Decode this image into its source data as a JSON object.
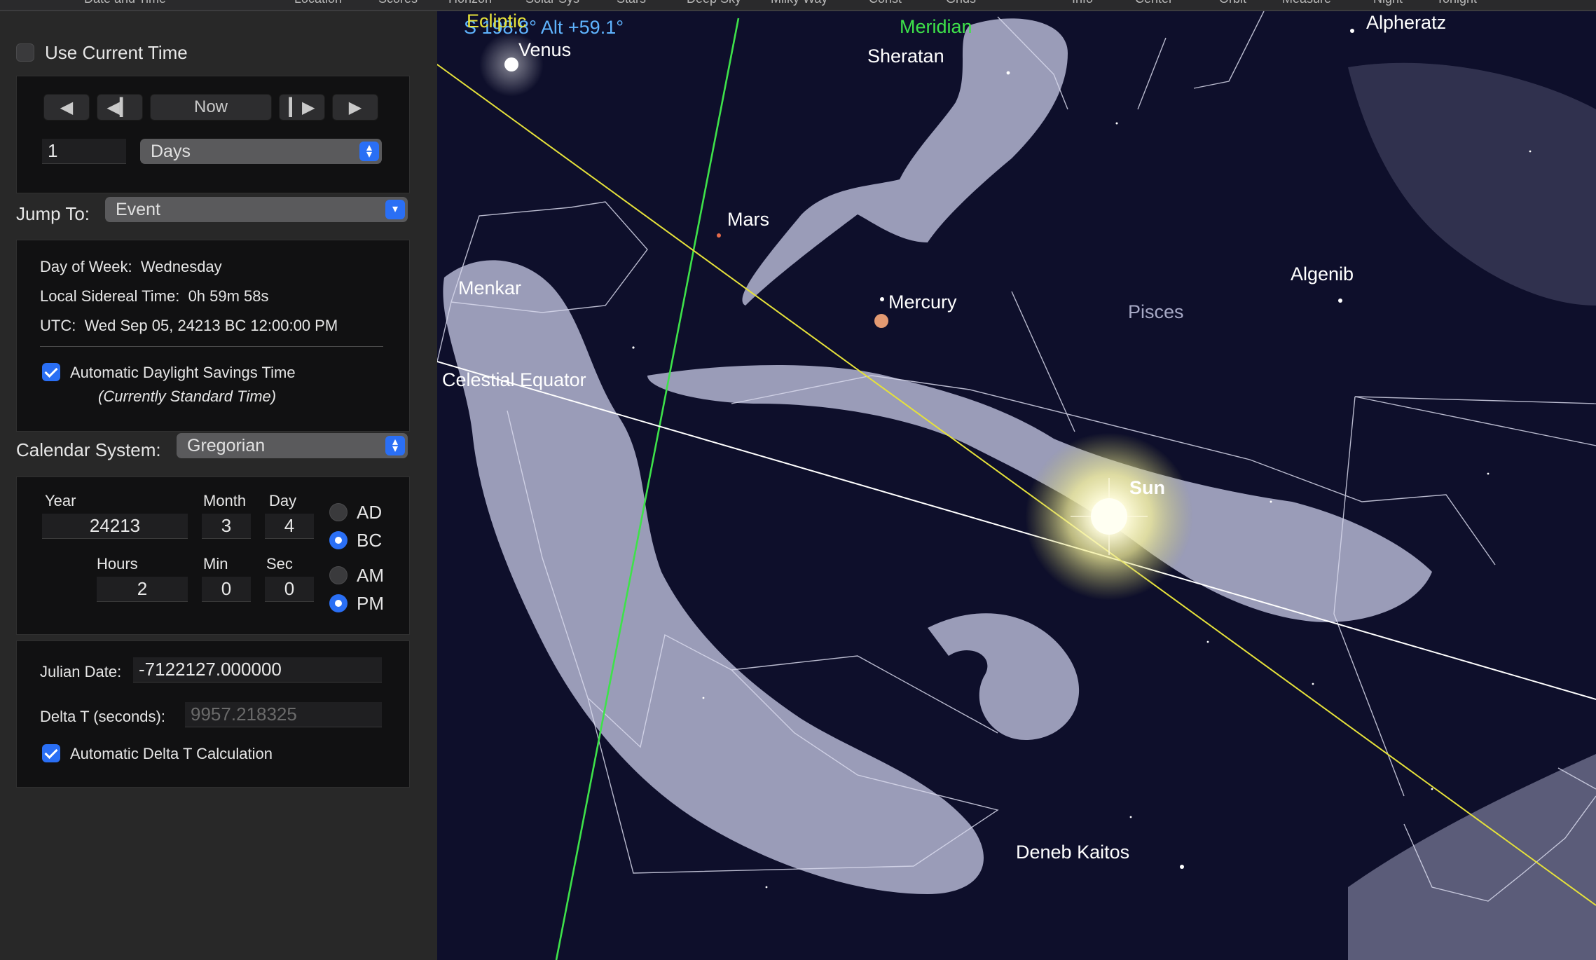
{
  "toolbar": {
    "items": [
      "Date and Time",
      "Location",
      "Scores",
      "Horizon",
      "Solar Sys",
      "Stars",
      "Deep Sky",
      "Milky Way",
      "Const",
      "Grids",
      "Info",
      "Center",
      "Orbit",
      "Measure",
      "Night",
      "Tonight"
    ]
  },
  "sidebar": {
    "use_current_time": {
      "label": "Use Current Time",
      "checked": false
    },
    "time_step": {
      "back_label": "◀",
      "step_back_label": "◀▎",
      "now_label": "Now",
      "step_forward_label": "▎▶",
      "forward_label": "▶",
      "amount": "1",
      "unit": "Days"
    },
    "jump_to": {
      "label": "Jump To:",
      "value": "Event"
    },
    "info": {
      "day_of_week_label": "Day of Week:",
      "day_of_week": "Wednesday",
      "lst_label": "Local Sidereal Time:",
      "lst": "0h 59m 58s",
      "utc_label": "UTC:",
      "utc": "Wed Sep 05, 24213 BC 12:00:00 PM",
      "auto_dst_label": "Automatic Daylight Savings Time",
      "auto_dst_checked": true,
      "dst_status": "(Currently Standard Time)"
    },
    "calendar": {
      "label": "Calendar System:",
      "value": "Gregorian"
    },
    "date": {
      "year_label": "Year",
      "year": "24213",
      "month_label": "Month",
      "month": "3",
      "day_label": "Day",
      "day": "4",
      "hours_label": "Hours",
      "hours": "2",
      "min_label": "Min",
      "min": "0",
      "sec_label": "Sec",
      "sec": "0",
      "ad_label": "AD",
      "bc_label": "BC",
      "era": "BC",
      "am_label": "AM",
      "pm_label": "PM",
      "meridiem": "PM"
    },
    "julian": {
      "label": "Julian Date:",
      "value": "-7122127.000000",
      "delta_t_label": "Delta T (seconds):",
      "delta_t": "9957.218325",
      "auto_delta_t_label": "Automatic Delta T Calculation",
      "auto_delta_t_checked": true
    }
  },
  "sky": {
    "direction_readout": "S 198.8° Alt +59.1°",
    "ecliptic_label": "Ecliptic",
    "meridian_label": "Meridian",
    "equator_label": "Celestial Equator",
    "constellation_label": "Pisces",
    "objects": {
      "venus": "Venus",
      "mars": "Mars",
      "mercury": "Mercury",
      "sun": "Sun"
    },
    "stars": {
      "sheratan": "Sheratan",
      "alpheratz": "Alpheratz",
      "menkar": "Menkar",
      "algenib": "Algenib",
      "deneb_kaitos": "Deneb Kaitos"
    },
    "colors": {
      "background": "#0e0f2b",
      "ecliptic": "#e6e23a",
      "meridian": "#3ee24a",
      "equator": "#ffffff",
      "readout": "#5fb4ff",
      "artwork": "#a7a9c6"
    }
  }
}
